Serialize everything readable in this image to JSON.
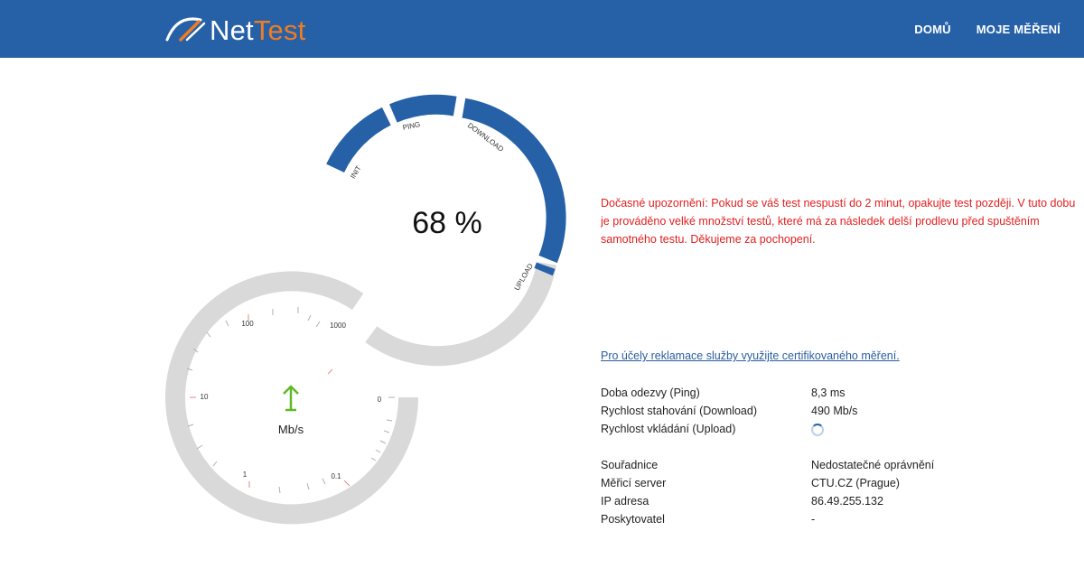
{
  "header": {
    "brand_part1": "Net",
    "brand_part2": "Test",
    "nav": [
      "DOMŮ",
      "MOJE MĚŘENÍ"
    ]
  },
  "progress": {
    "percent_text": "68 %",
    "percent": 68,
    "phases": [
      "INIT",
      "PING",
      "DOWNLOAD",
      "UPLOAD"
    ]
  },
  "speedometer": {
    "unit": "Mb/s",
    "ticks": [
      "0",
      "0.1",
      "1",
      "10",
      "100",
      "1000"
    ],
    "arrow_icon": "upload-arrow-icon"
  },
  "notice": {
    "lines": [
      "Dočasné upozornění: Pokud se váš test nespustí do 2 minut, opakujte test později. V tuto dobu",
      "je prováděno velké množství testů, které má za následek delší prodlevu před spuštěním",
      "samotného testu. Děkujeme za pochopení."
    ]
  },
  "certified_link": "Pro účely reklamace služby využijte certifikovaného měření.",
  "results": [
    {
      "label": "Doba odezvy (Ping)",
      "value": "8,3 ms"
    },
    {
      "label": "Rychlost stahování (Download)",
      "value": "490 Mb/s"
    },
    {
      "label": "Rychlost vkládání (Upload)",
      "value": ""
    }
  ],
  "info": [
    {
      "label": "Souřadnice",
      "value": "Nedostatečné oprávnění"
    },
    {
      "label": "Měřicí server",
      "value": "CTU.CZ (Prague)"
    },
    {
      "label": "IP adresa",
      "value": "86.49.255.132"
    },
    {
      "label": "Poskytovatel",
      "value": "-"
    }
  ],
  "colors": {
    "header": "#2661a8",
    "accent_orange": "#f07c22",
    "progress": "#2661a8",
    "track": "#d9d9d9",
    "warning": "#e02020",
    "link": "#2a5d9f",
    "arrow": "#5fb827"
  }
}
